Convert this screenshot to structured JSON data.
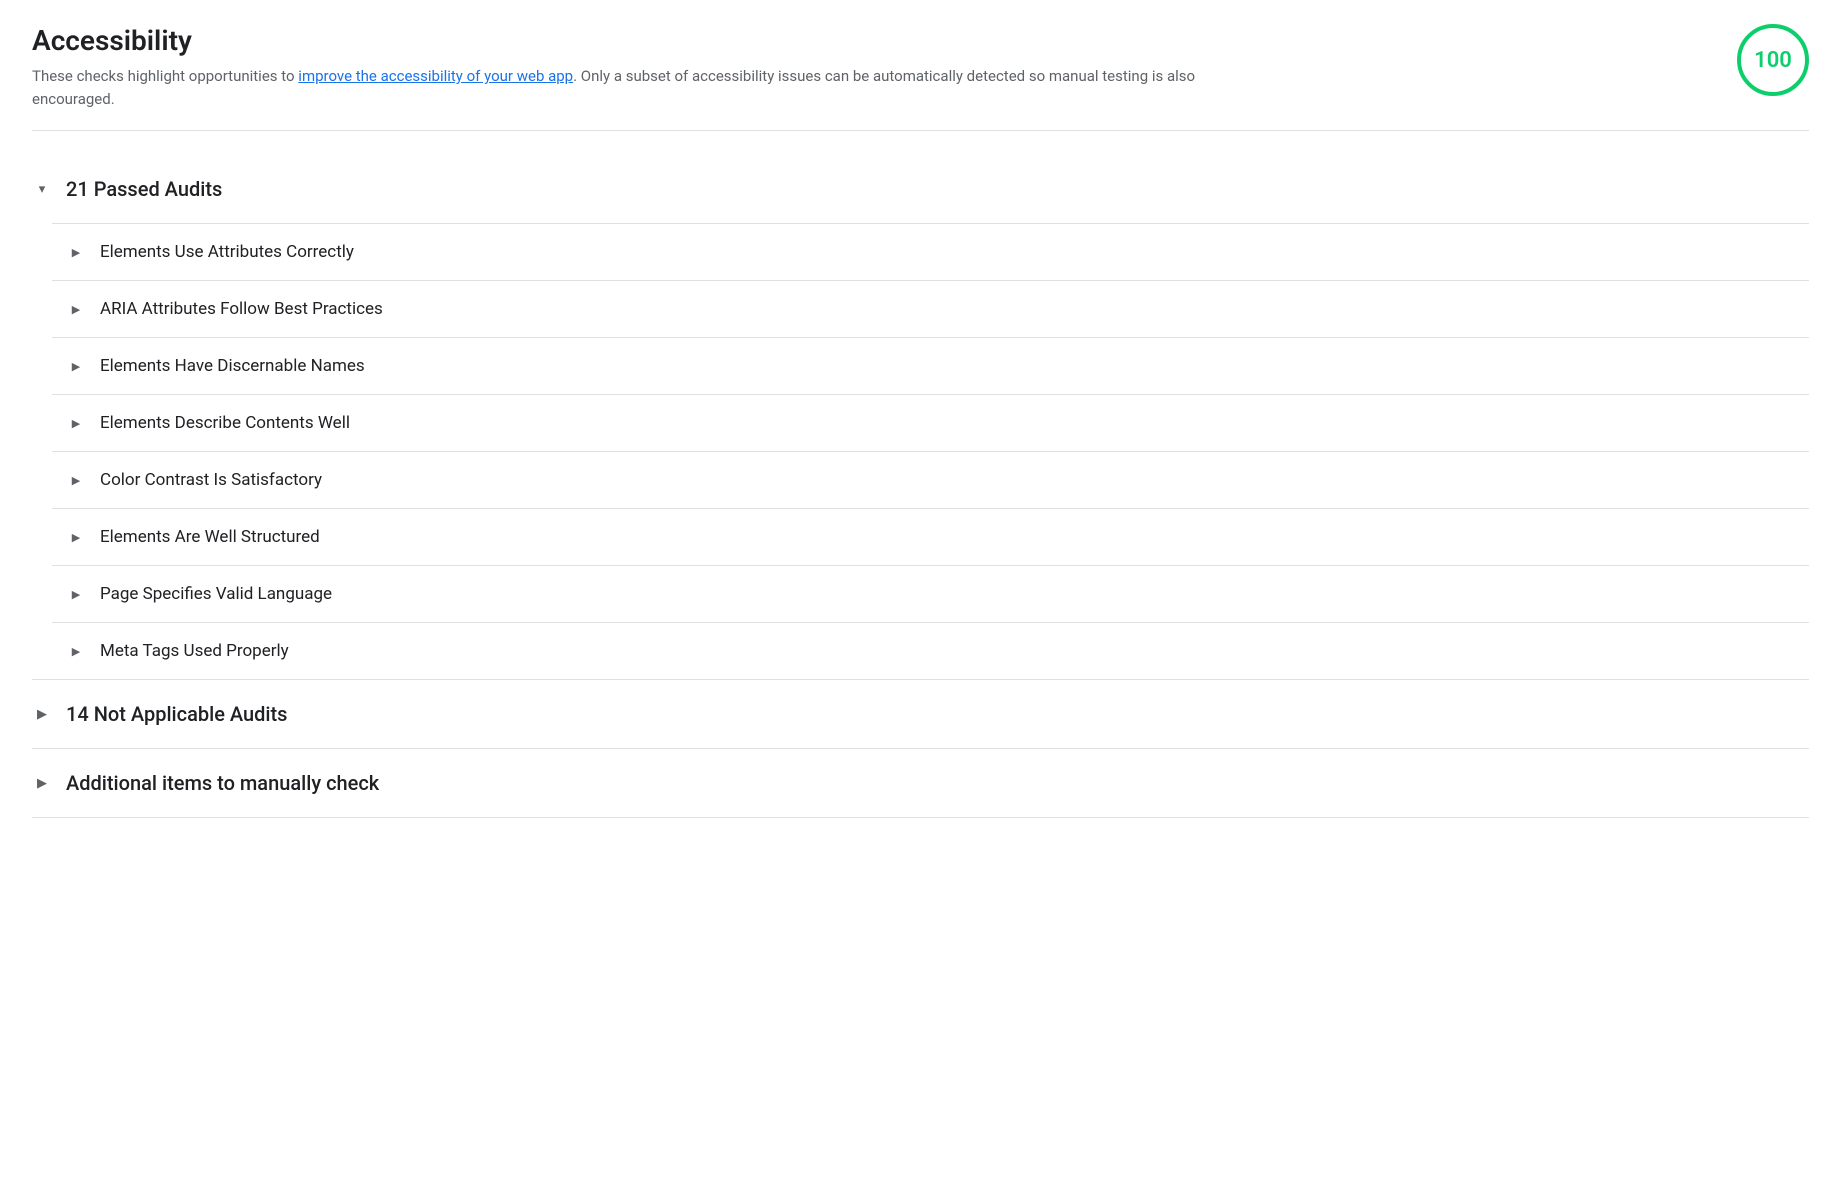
{
  "header": {
    "title": "Accessibility",
    "description_before": "These checks highlight opportunities to ",
    "link_text": "improve the accessibility of your web app",
    "description_after": ". Only a subset of accessibility issues can be automatically detected so manual testing is also encouraged.",
    "score": "100",
    "score_color": "#0cce6b"
  },
  "passed_audits": {
    "label": "21 Passed Audits",
    "items": [
      {
        "label": "Elements Use Attributes Correctly"
      },
      {
        "label": "ARIA Attributes Follow Best Practices"
      },
      {
        "label": "Elements Have Discernable Names"
      },
      {
        "label": "Elements Describe Contents Well"
      },
      {
        "label": "Color Contrast Is Satisfactory"
      },
      {
        "label": "Elements Are Well Structured"
      },
      {
        "label": "Page Specifies Valid Language"
      },
      {
        "label": "Meta Tags Used Properly"
      }
    ]
  },
  "not_applicable": {
    "label": "14 Not Applicable Audits"
  },
  "manual_check": {
    "label": "Additional items to manually check"
  },
  "icons": {
    "chevron_right": "▶",
    "chevron_down": "▾"
  }
}
